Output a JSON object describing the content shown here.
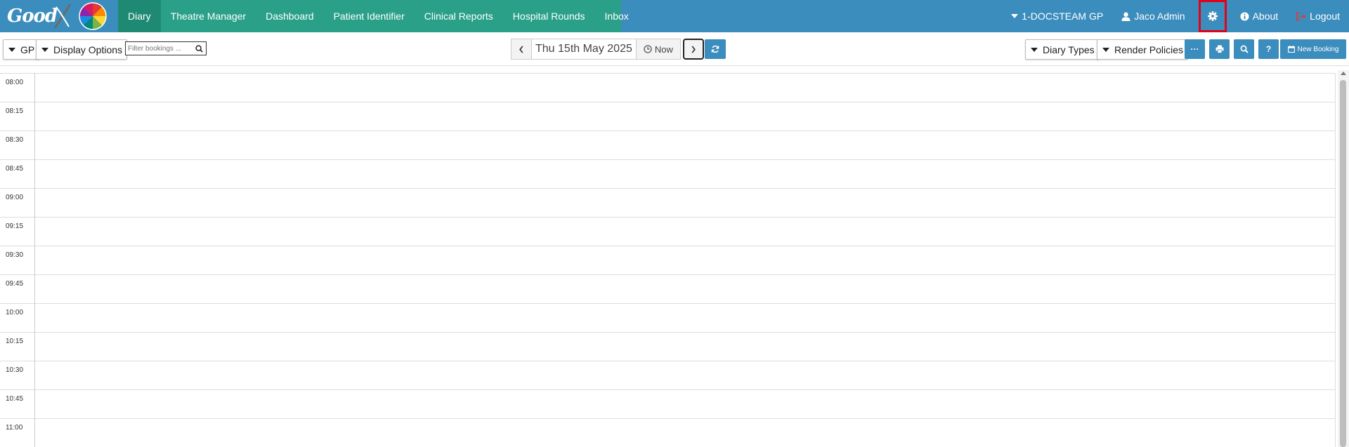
{
  "logo": {
    "text": "Good"
  },
  "nav": {
    "items": [
      {
        "label": "Diary",
        "active": true
      },
      {
        "label": "Theatre Manager",
        "active": false
      },
      {
        "label": "Dashboard",
        "active": false
      },
      {
        "label": "Patient Identifier",
        "active": false
      },
      {
        "label": "Clinical Reports",
        "active": false
      },
      {
        "label": "Hospital Rounds",
        "active": false
      },
      {
        "label": "Inbox",
        "active": false
      }
    ],
    "practice": "1-DOCSTEAM GP",
    "user": "Jaco Admin",
    "about": "About",
    "logout": "Logout"
  },
  "toolbar": {
    "gp_label": "GP",
    "display_options_label": "Display Options",
    "filter_placeholder": "Filter bookings ...",
    "date": "Thu 15th May 2025",
    "now_label": "Now",
    "diary_types_label": "Diary Types",
    "render_policies_label": "Render Policies",
    "more_label": "···",
    "help_label": "?",
    "new_booking_label": "New Booking"
  },
  "slots": [
    "08:00",
    "08:15",
    "08:30",
    "08:45",
    "09:00",
    "09:15",
    "09:30",
    "09:45",
    "10:00",
    "10:15",
    "10:30",
    "10:45",
    "11:00"
  ],
  "colors": {
    "nav_blue": "#3b8dbd",
    "nav_green": "#2aa089",
    "nav_active": "#1f8a74",
    "highlight": "#e3001b"
  }
}
